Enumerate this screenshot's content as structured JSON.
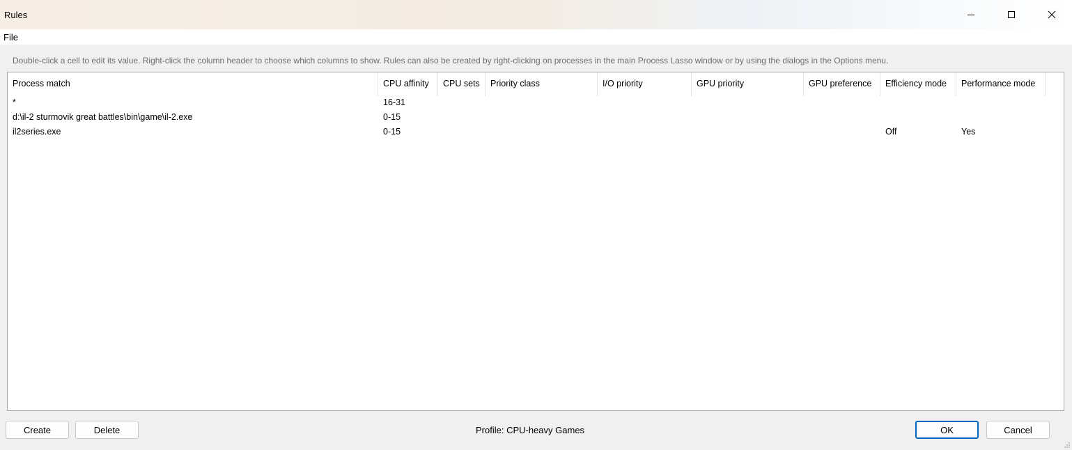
{
  "window": {
    "title": "Rules"
  },
  "menu": {
    "file": "File"
  },
  "hint": "Double-click a cell to edit its value. Right-click the column header to choose which columns to show. Rules can also be created by right-clicking on processes in the main Process Lasso window or by using the dialogs in the Options menu.",
  "table": {
    "columns": [
      "Process match",
      "CPU affinity",
      "CPU sets",
      "Priority class",
      "I/O priority",
      "GPU priority",
      "GPU preference",
      "Efficiency mode",
      "Performance mode"
    ],
    "rows": [
      [
        "*",
        "16-31",
        "",
        "",
        "",
        "",
        "",
        "",
        ""
      ],
      [
        "d:\\il-2 sturmovik great battles\\bin\\game\\il-2.exe",
        "0-15",
        "",
        "",
        "",
        "",
        "",
        "",
        ""
      ],
      [
        "il2series.exe",
        "0-15",
        "",
        "",
        "",
        "",
        "",
        "Off",
        "Yes"
      ]
    ]
  },
  "footer": {
    "create": "Create",
    "delete": "Delete",
    "profile": "Profile: CPU-heavy Games",
    "ok": "OK",
    "cancel": "Cancel"
  },
  "icons": {
    "minimize": "minimize-icon",
    "maximize": "maximize-icon",
    "close": "close-icon",
    "grip": "resize-grip-icon"
  },
  "colors": {
    "accent": "#0067c0",
    "hint_text": "#6b6b6b",
    "dialog_bg": "#f0f0f0"
  }
}
